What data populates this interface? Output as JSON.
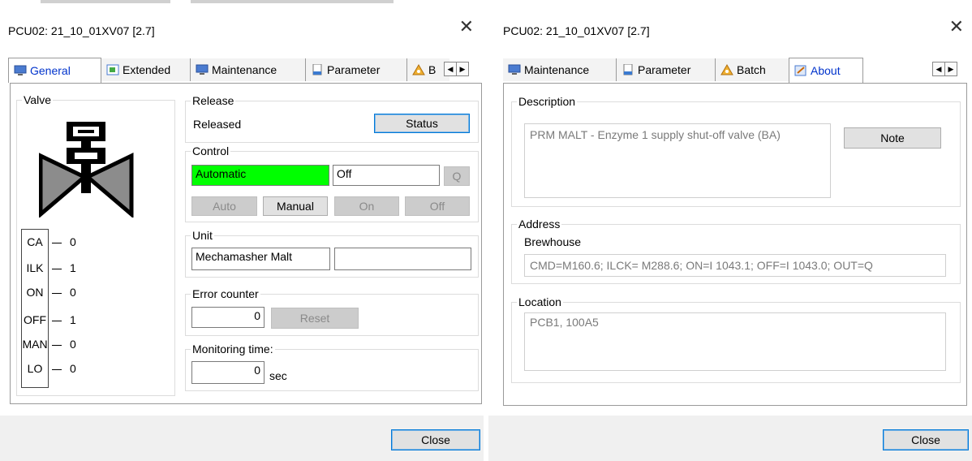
{
  "left": {
    "title": "PCU02: 21_10_01XV07 [2.7]",
    "tabs": [
      "General",
      "Extended",
      "Maintenance",
      "Parameter",
      "B"
    ],
    "valve_label": "Valve",
    "signals": [
      {
        "name": "CA",
        "value": "0"
      },
      {
        "name": "ILK",
        "value": "1"
      },
      {
        "name": "ON",
        "value": "0"
      },
      {
        "name": "OFF",
        "value": "1"
      },
      {
        "name": "MAN",
        "value": "0"
      },
      {
        "name": "LO",
        "value": "0"
      }
    ],
    "release": {
      "label": "Release",
      "state": "Released",
      "status_button": "Status"
    },
    "control": {
      "label": "Control",
      "mode": "Automatic",
      "output": "Off",
      "q_button": "Q",
      "buttons": [
        "Auto",
        "Manual",
        "On",
        "Off"
      ],
      "mode_color": "#00ff00"
    },
    "unit": {
      "label": "Unit",
      "value": "Mechamasher Malt",
      "value2": ""
    },
    "error_counter": {
      "label": "Error counter",
      "value": "0",
      "reset_button": "Reset"
    },
    "monitoring": {
      "label": "Monitoring time:",
      "value": "0",
      "unit": "sec"
    },
    "close_button": "Close"
  },
  "right": {
    "title": "PCU02: 21_10_01XV07 [2.7]",
    "tabs": [
      "Maintenance",
      "Parameter",
      "Batch",
      "About"
    ],
    "description": {
      "label": "Description",
      "value": "PRM MALT - Enzyme 1 supply shut-off valve (BA)",
      "note_button": "Note"
    },
    "address": {
      "label": "Address",
      "sub_label": "Brewhouse",
      "value": "CMD=M160.6; ILCK= M288.6; ON=I 1043.1; OFF=I 1043.0; OUT=Q"
    },
    "location": {
      "label": "Location",
      "value": "PCB1, 100A5"
    },
    "close_button": "Close"
  },
  "colors": {
    "accent": "#0078d7",
    "automatic": "#00ff00",
    "footer": "#f0f0f0"
  }
}
